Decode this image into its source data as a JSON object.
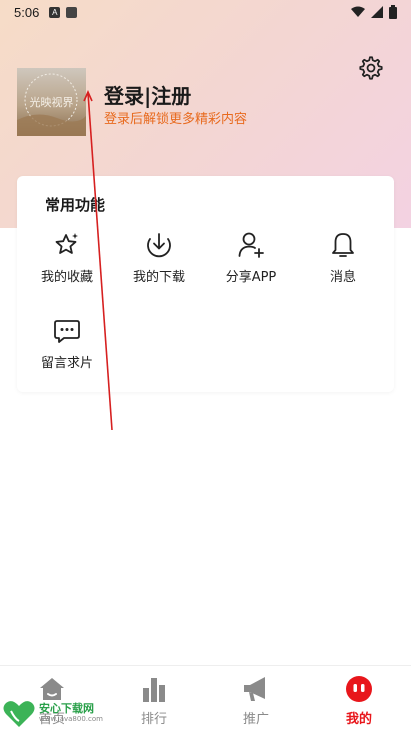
{
  "status_bar": {
    "time": "5:06",
    "left_icons": [
      "a-badge-icon",
      "sim-icon"
    ],
    "right_icons": [
      "wifi-icon",
      "signal-icon",
      "battery-icon"
    ]
  },
  "profile": {
    "avatar_text": "光映视界",
    "login_label": "登录|注册",
    "login_subtitle": "登录后解锁更多精彩内容"
  },
  "functions": {
    "title": "常用功能",
    "items": [
      {
        "label": "我的收藏",
        "icon": "star-icon"
      },
      {
        "label": "我的下载",
        "icon": "download-icon"
      },
      {
        "label": "分享APP",
        "icon": "add-user-icon"
      },
      {
        "label": "消息",
        "icon": "bell-icon"
      },
      {
        "label": "留言求片",
        "icon": "message-icon"
      }
    ]
  },
  "bottom_nav": {
    "items": [
      {
        "label": "首页",
        "icon": "home-icon"
      },
      {
        "label": "排行",
        "icon": "bar-chart-icon"
      },
      {
        "label": "推广",
        "icon": "megaphone-icon"
      },
      {
        "label": "我的",
        "icon": "mine-icon",
        "active": true
      }
    ]
  },
  "watermark": {
    "main": "安心下载网",
    "sub": "www.java800.com"
  },
  "colors": {
    "accent_red": "#e8161b",
    "subtitle_orange": "#e86a1e",
    "nav_inactive": "#8a8a8a"
  }
}
